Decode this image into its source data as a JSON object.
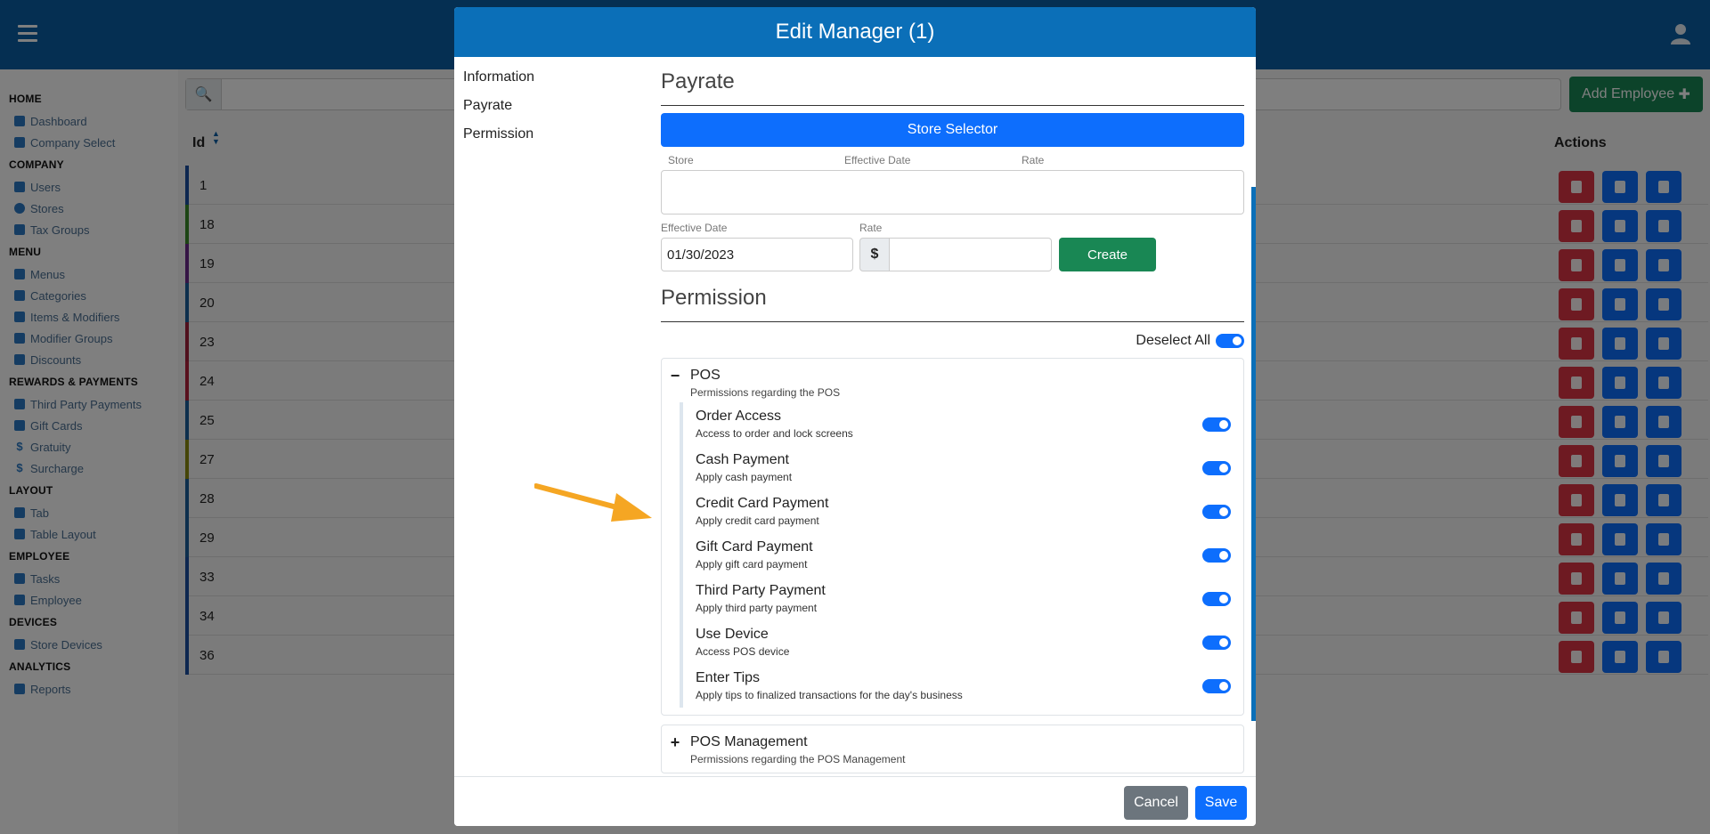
{
  "sidebar": {
    "sections": [
      {
        "title": "HOME",
        "items": [
          {
            "label": "Dashboard",
            "icon": "dashboard-icon"
          },
          {
            "label": "Company Select",
            "icon": "home-icon"
          }
        ]
      },
      {
        "title": "COMPANY",
        "items": [
          {
            "label": "Users",
            "icon": "users-icon"
          },
          {
            "label": "Stores",
            "icon": "map-marker-icon"
          },
          {
            "label": "Tax Groups",
            "icon": "building-icon"
          }
        ]
      },
      {
        "title": "MENU",
        "items": [
          {
            "label": "Menus",
            "icon": "utensils-icon"
          },
          {
            "label": "Categories",
            "icon": "categories-icon"
          },
          {
            "label": "Items & Modifiers",
            "icon": "list-icon"
          },
          {
            "label": "Modifier Groups",
            "icon": "layers-icon"
          },
          {
            "label": "Discounts",
            "icon": "tag-icon"
          }
        ]
      },
      {
        "title": "REWARDS & PAYMENTS",
        "items": [
          {
            "label": "Third Party Payments",
            "icon": "money-icon"
          },
          {
            "label": "Gift Cards",
            "icon": "gift-card-icon"
          },
          {
            "label": "Gratuity",
            "icon": "dollar-icon"
          },
          {
            "label": "Surcharge",
            "icon": "dollar-icon"
          }
        ]
      },
      {
        "title": "LAYOUT",
        "items": [
          {
            "label": "Tab",
            "icon": "table-icon"
          },
          {
            "label": "Table Layout",
            "icon": "map-icon"
          }
        ]
      },
      {
        "title": "EMPLOYEE",
        "items": [
          {
            "label": "Tasks",
            "icon": "tasks-icon"
          },
          {
            "label": "Employee",
            "icon": "id-card-icon"
          }
        ]
      },
      {
        "title": "DEVICES",
        "items": [
          {
            "label": "Store Devices",
            "icon": "laptop-icon"
          }
        ]
      },
      {
        "title": "ANALYTICS",
        "items": [
          {
            "label": "Reports",
            "icon": "chart-icon"
          }
        ]
      }
    ]
  },
  "main": {
    "add_employee_label": "Add Employee",
    "col_id": "Id",
    "col_actions": "Actions",
    "rows": [
      {
        "id": "1",
        "color": "#1a4fa0"
      },
      {
        "id": "18",
        "color": "#3a8a2a"
      },
      {
        "id": "19",
        "color": "#6a2a8a"
      },
      {
        "id": "20",
        "color": "#1a5f9a"
      },
      {
        "id": "23",
        "color": "#a0203a"
      },
      {
        "id": "24",
        "color": "#b0203a"
      },
      {
        "id": "25",
        "color": "#1a5f9a"
      },
      {
        "id": "27",
        "color": "#8a8a10"
      },
      {
        "id": "28",
        "color": "#1a5f9a"
      },
      {
        "id": "29",
        "color": "#1a5f9a"
      },
      {
        "id": "33",
        "color": "#1a4fa0"
      },
      {
        "id": "34",
        "color": "#1a4fa0"
      },
      {
        "id": "36",
        "color": "#1a4fa0"
      }
    ]
  },
  "modal": {
    "title": "Edit Manager (1)",
    "nav": [
      "Information",
      "Payrate",
      "Permission"
    ],
    "payrate": {
      "title": "Payrate",
      "store_selector": "Store Selector",
      "columns": [
        "Store",
        "Effective Date",
        "Rate"
      ],
      "effective_date_label": "Effective Date",
      "effective_date_value": "01/30/2023",
      "rate_label": "Rate",
      "rate_prefix": "$",
      "rate_value": "",
      "create_label": "Create"
    },
    "permission": {
      "title": "Permission",
      "deselect_all": "Deselect All",
      "groups": [
        {
          "sign": "−",
          "title": "POS",
          "desc": "Permissions regarding the POS",
          "items": [
            {
              "name": "Order Access",
              "desc": "Access to order and lock screens",
              "on": true
            },
            {
              "name": "Cash Payment",
              "desc": "Apply cash payment",
              "on": true
            },
            {
              "name": "Credit Card Payment",
              "desc": "Apply credit card payment",
              "on": true
            },
            {
              "name": "Gift Card Payment",
              "desc": "Apply gift card payment",
              "on": true
            },
            {
              "name": "Third Party Payment",
              "desc": "Apply third party payment",
              "on": true
            },
            {
              "name": "Use Device",
              "desc": "Access POS device",
              "on": true
            },
            {
              "name": "Enter Tips",
              "desc": "Apply tips to finalized transactions for the day's business",
              "on": true
            }
          ]
        },
        {
          "sign": "+",
          "title": "POS Management",
          "desc": "Permissions regarding the POS Management",
          "items": []
        }
      ]
    },
    "cancel_label": "Cancel",
    "save_label": "Save"
  },
  "colors": {
    "header": "#0b5fa5",
    "primary": "#0d6efd",
    "success": "#198754",
    "danger": "#dc3545",
    "arrow": "#f5a623"
  }
}
